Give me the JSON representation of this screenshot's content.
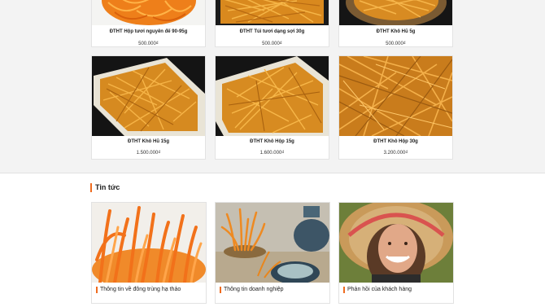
{
  "products": [
    {
      "name": "ĐTHT Hộp tươi nguyên đế 90-95g",
      "price": "500.000₫"
    },
    {
      "name": "ĐTHT Túi tươi dạng sợi 30g",
      "price": "500.000₫"
    },
    {
      "name": "ĐTHT Khô Hũ 5g",
      "price": "500.000₫"
    },
    {
      "name": "ĐTHT Khô Hũ 15g",
      "price": "1.500.000₫"
    },
    {
      "name": "ĐTHT Khô Hộp 15g",
      "price": "1.600.000₫"
    },
    {
      "name": "ĐTHT Khô Hộp 30g",
      "price": "3.200.000₫"
    }
  ],
  "news": {
    "title": "Tin tức",
    "items": [
      {
        "label": "Thông tin về đông trùng hạ thảo"
      },
      {
        "label": "Thông tin doanh nghiệp"
      },
      {
        "label": "Phản hồi của khách hàng"
      }
    ]
  },
  "colors": {
    "accent": "#ef6b1f",
    "cordyceps": "#e8891c",
    "page_bg": "#f3f3f3"
  }
}
